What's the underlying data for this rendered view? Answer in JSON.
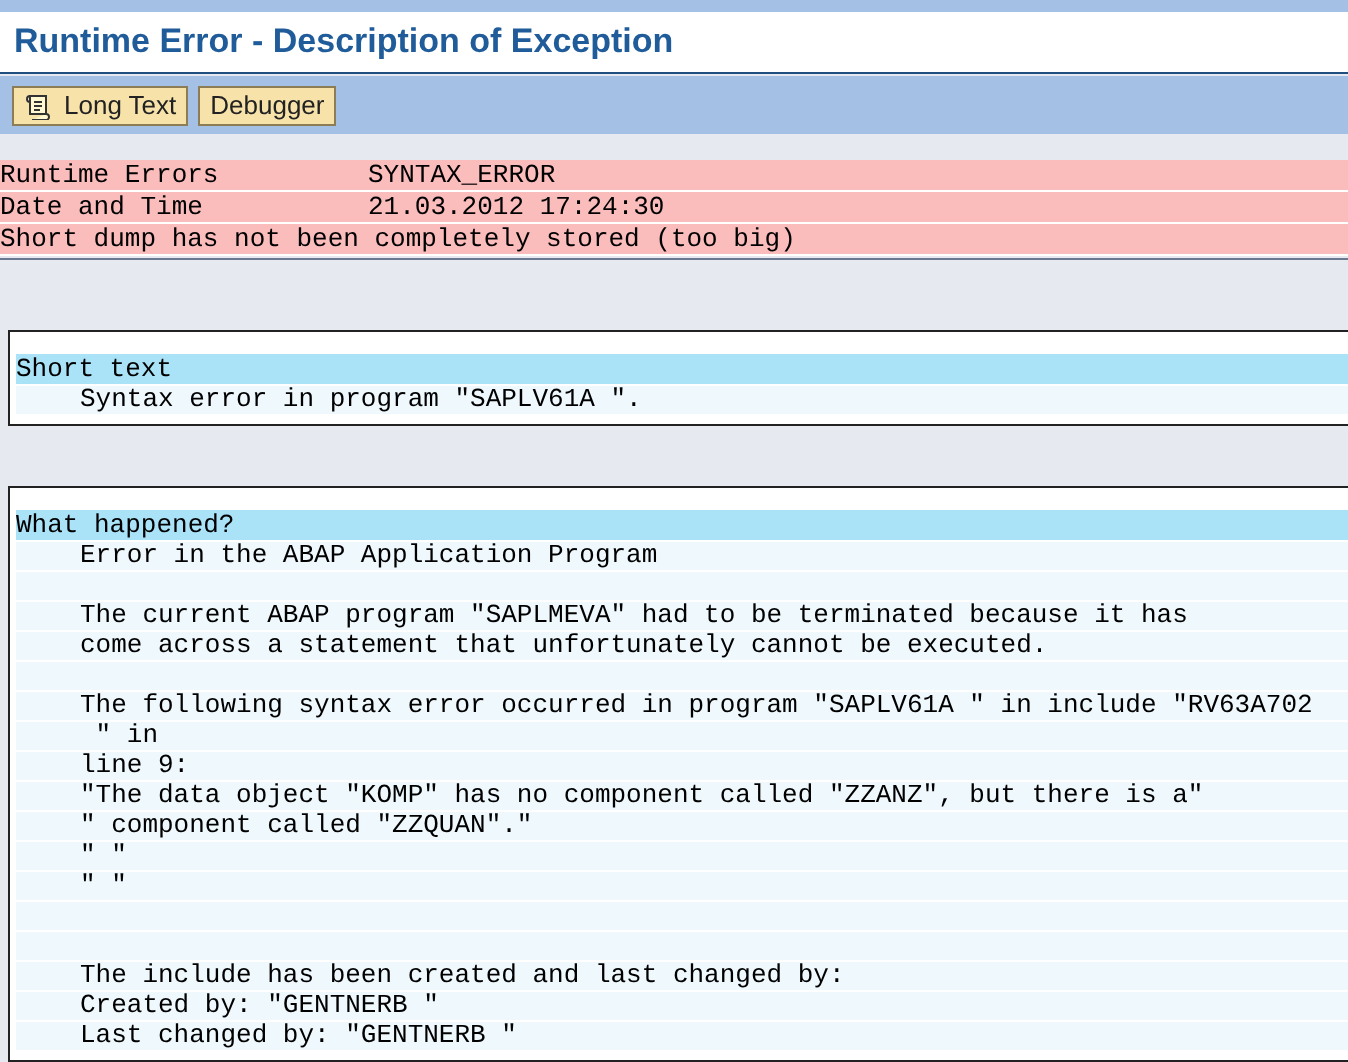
{
  "window": {
    "title": "Runtime Error - Description of Exception"
  },
  "toolbar": [
    {
      "label": "Long Text",
      "kind": "icon"
    },
    {
      "label": "Debugger",
      "kind": "plain"
    }
  ],
  "header_rows": [
    {
      "label": "Runtime Errors",
      "value": "SYNTAX_ERROR"
    },
    {
      "label": "Date and Time",
      "value": "21.03.2012 17:24:30"
    },
    {
      "label": "Short dump has not been completely stored (too big)"
    }
  ],
  "sections": [
    {
      "title": "Short text",
      "lines": [
        {
          "kind": "text",
          "text": "Syntax error in program \"SAPLV61A \"."
        }
      ]
    },
    {
      "title": "What happened?",
      "lines": [
        {
          "kind": "text",
          "text": "Error in the ABAP Application Program"
        },
        {
          "kind": "blank"
        },
        {
          "kind": "text",
          "text": "The current ABAP program \"SAPLMEVA\" had to be terminated because it has"
        },
        {
          "kind": "text",
          "text": "come across a statement that unfortunately cannot be executed."
        },
        {
          "kind": "blank"
        },
        {
          "kind": "text",
          "text": "The following syntax error occurred in program \"SAPLV61A \" in include \"RV63A702"
        },
        {
          "kind": "text",
          "text": " \" in"
        },
        {
          "kind": "text",
          "text": "line 9:"
        },
        {
          "kind": "text",
          "text": "\"The data object \"KOMP\" has no component called \"ZZANZ\", but there is a\""
        },
        {
          "kind": "text",
          "text": "\" component called \"ZZQUAN\".\""
        },
        {
          "kind": "text",
          "text": "\" \""
        },
        {
          "kind": "text",
          "text": "\" \""
        },
        {
          "kind": "blank"
        },
        {
          "kind": "blank"
        },
        {
          "kind": "text",
          "text": "The include has been created and last changed by:"
        },
        {
          "kind": "text",
          "text": "Created by: \"GENTNERB \""
        },
        {
          "kind": "text",
          "text": "Last changed by: \"GENTNERB \""
        }
      ]
    }
  ]
}
